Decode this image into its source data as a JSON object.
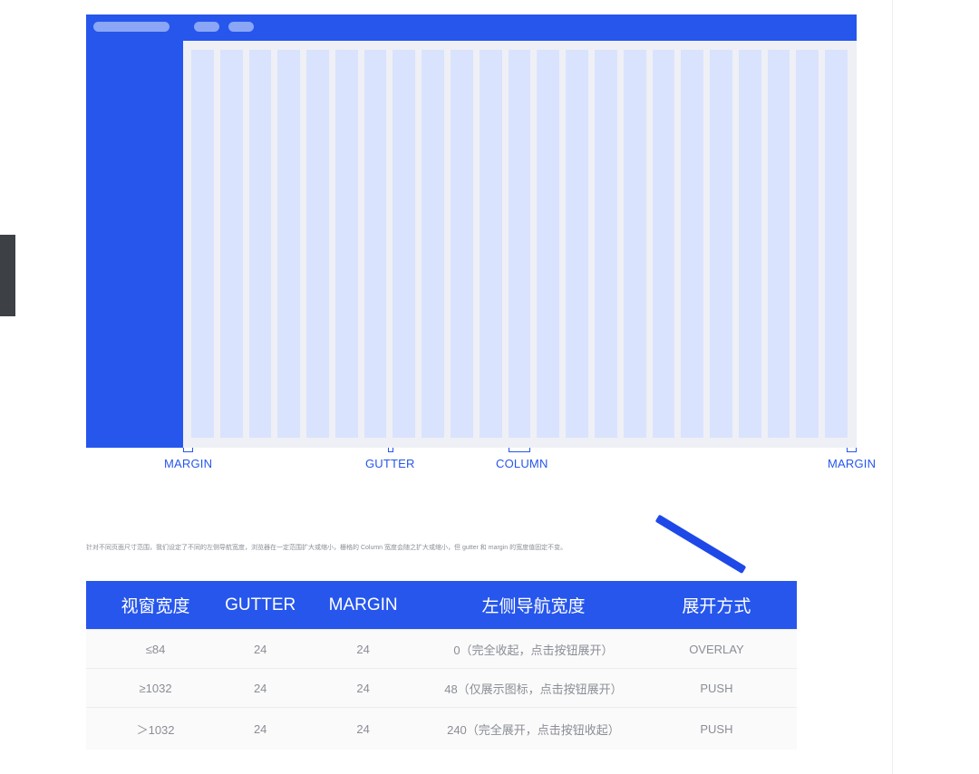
{
  "diagram": {
    "labels": {
      "margin_left": "MARGIN",
      "gutter": "GUTTER",
      "column": "COLUMN",
      "margin_right": "MARGIN"
    },
    "column_count": 23,
    "colors": {
      "primary": "#2656ec",
      "column": "#dae3fd",
      "canvas": "#eef0f5",
      "pill": "#8aa6f5"
    }
  },
  "note": "针对不同页面尺寸范围，我们设定了不同的左侧导航宽度，浏览器在一定范围扩大或缩小，栅格的 Column 宽度会随之扩大或缩小，但 gutter 和 margin 的宽度值固定不变。",
  "table": {
    "headers": [
      "视窗宽度",
      "GUTTER",
      "MARGIN",
      "左侧导航宽度",
      "展开方式"
    ],
    "rows": [
      [
        "≤84",
        "24",
        "24",
        "0（完全收起，点击按钮展开）",
        "OVERLAY"
      ],
      [
        "≥1032",
        "24",
        "24",
        "48（仅展示图标，点击按钮展开）",
        "PUSH"
      ],
      [
        "＞1032",
        "24",
        "24",
        "240（完全展开，点击按钮收起）",
        "PUSH"
      ]
    ]
  }
}
